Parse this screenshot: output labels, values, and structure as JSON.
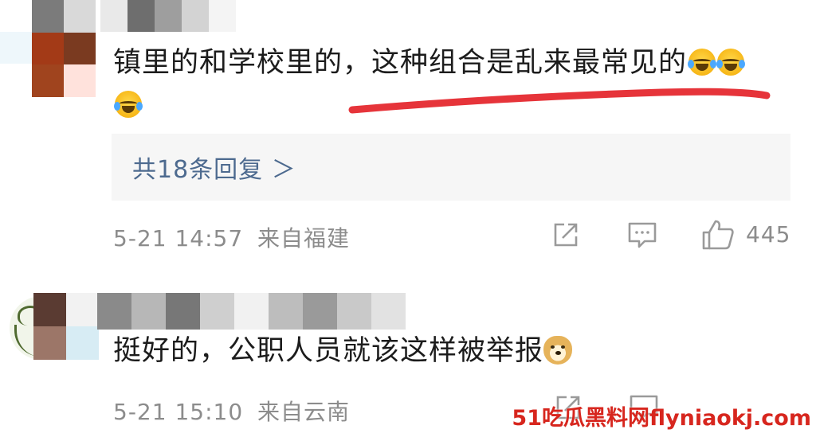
{
  "comments": [
    {
      "text": "镇里的和学校里的，这种组合是乱来最常见的",
      "emojis": [
        "laugh-cry",
        "laugh-cry",
        "laugh-cry"
      ],
      "reply_summary": "共18条回复 ＞",
      "date": "5-21 14:57",
      "location": "来自福建",
      "likes": "445"
    },
    {
      "text": "挺好的，公职人员就该这样被举报",
      "emoji": "doge",
      "date": "5-21 15:10",
      "location": "来自云南"
    }
  ],
  "watermark": "51吃瓜黑料网flyniaokj.com",
  "colors": {
    "underline": "#e6343a",
    "reply_link": "#4d6a8f",
    "meta": "#8c8c8c",
    "watermark": "#d7261e"
  },
  "icons": [
    "share-icon",
    "comment-icon",
    "like-icon"
  ]
}
